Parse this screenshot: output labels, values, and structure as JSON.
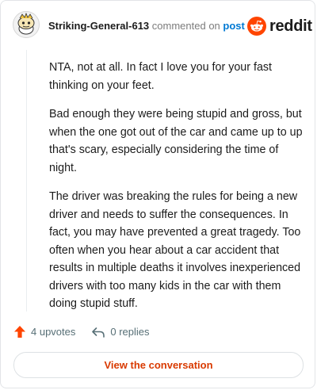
{
  "comment": {
    "author": "Striking-General-613",
    "action_text": "commented on",
    "post_link_text": "post",
    "paragraphs": [
      "NTA, not at all. In fact I love you for your fast thinking on your feet.",
      "Bad enough they were being stupid and gross, but when the one got out of the car and came up to up that's scary, especially considering the time of night.",
      "The driver was breaking the rules for being a new driver and needs to suffer the consequences. In fact, you may have prevented a great tragedy. Too often when you hear about a car accident that results in multiple deaths it involves inexperienced drivers with too many kids in the car with them doing stupid stuff."
    ],
    "upvotes_label": "4 upvotes",
    "replies_label": "0 replies"
  },
  "brand": {
    "wordmark": "reddit"
  },
  "footer": {
    "view_label": "View the conversation"
  },
  "colors": {
    "accent": "#ff4500",
    "link": "#0079d3",
    "button_text": "#d93a00"
  },
  "icons": {
    "avatar": "snoo-avatar-icon",
    "logo": "reddit-logo-icon",
    "upvote": "upvote-arrow-icon",
    "reply": "reply-arrow-icon"
  }
}
